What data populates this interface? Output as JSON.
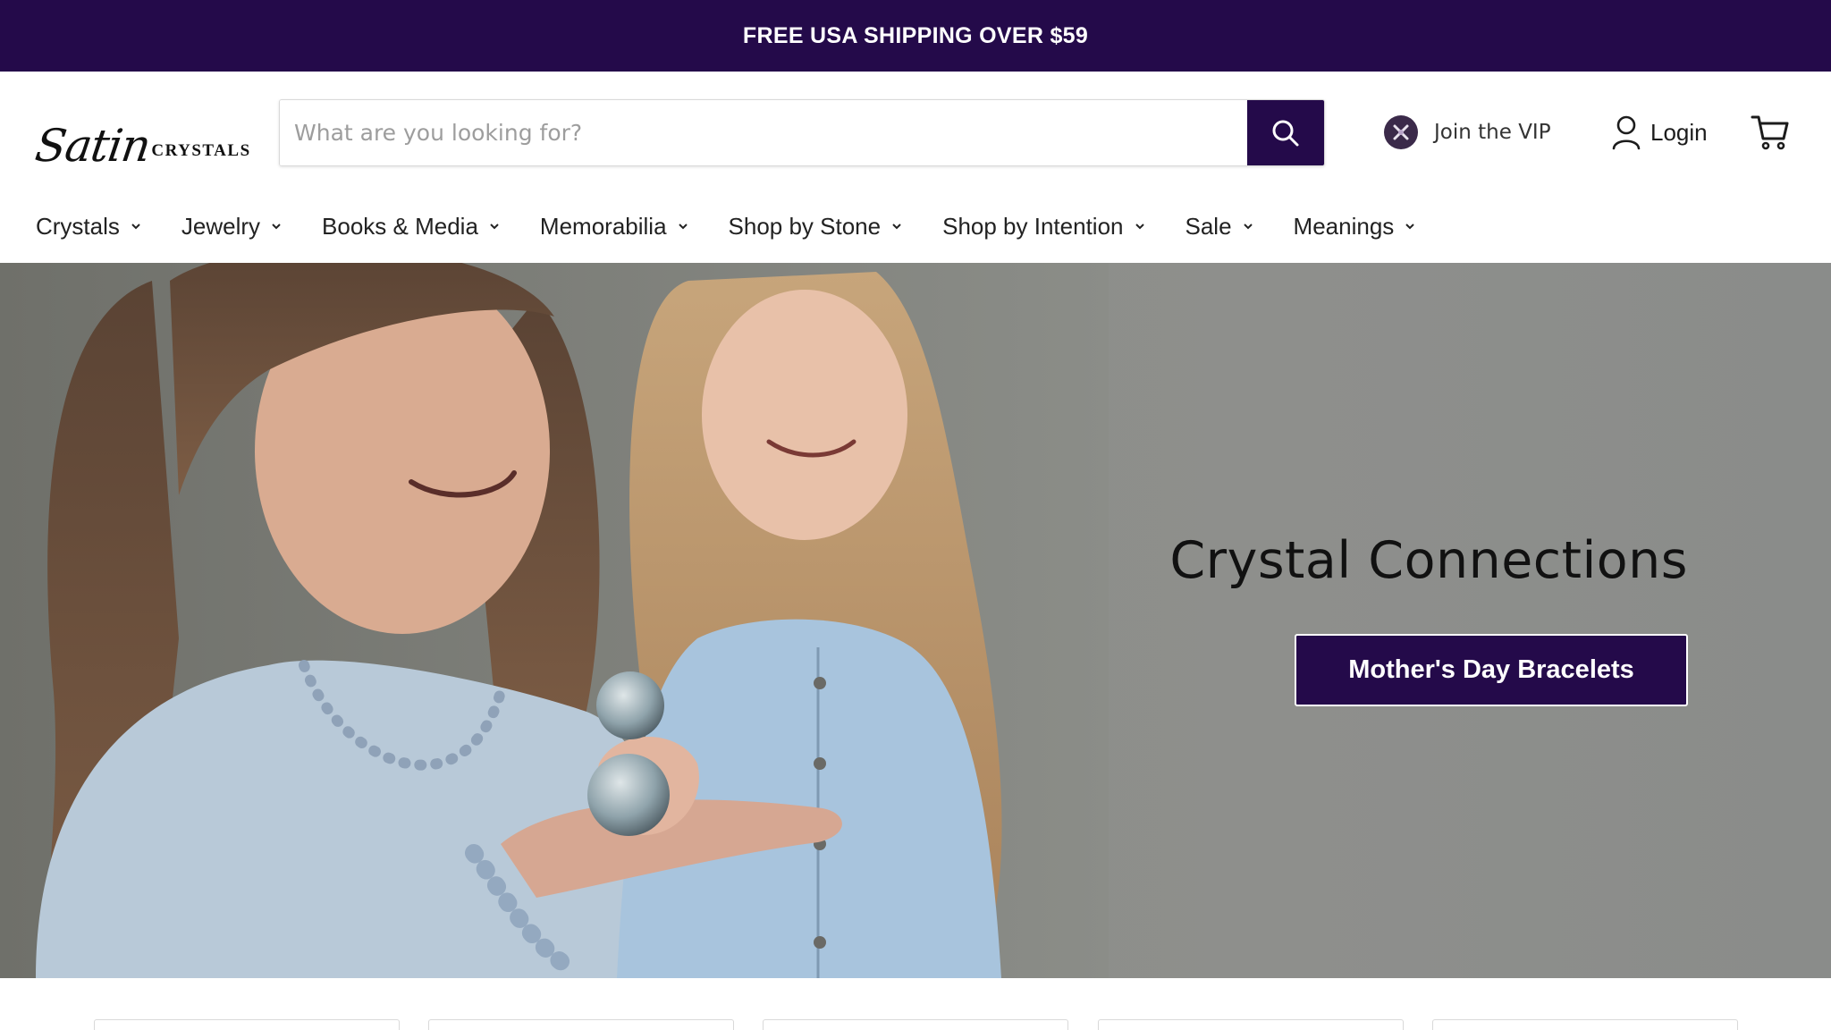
{
  "announcement": {
    "text": "FREE USA SHIPPING OVER $59"
  },
  "header": {
    "logo": {
      "script": "Satin",
      "caps": "CRYSTALS"
    },
    "search": {
      "placeholder": "What are you looking for?",
      "value": "",
      "button_icon": "search-icon"
    },
    "vip": {
      "label": "Join the VIP",
      "icon": "vip-badge-icon"
    },
    "login": {
      "label": "Login",
      "icon": "user-icon"
    },
    "cart": {
      "icon": "cart-icon"
    }
  },
  "nav": {
    "items": [
      {
        "label": "Crystals"
      },
      {
        "label": "Jewelry"
      },
      {
        "label": "Books & Media"
      },
      {
        "label": "Memorabilia"
      },
      {
        "label": "Shop by Stone"
      },
      {
        "label": "Shop by Intention"
      },
      {
        "label": "Sale"
      },
      {
        "label": "Meanings"
      }
    ]
  },
  "hero": {
    "title": "Crystal Connections",
    "cta": "Mother's Day Bracelets"
  },
  "colors": {
    "brand": "#240a4a",
    "hero_background": "#8c8e89"
  }
}
